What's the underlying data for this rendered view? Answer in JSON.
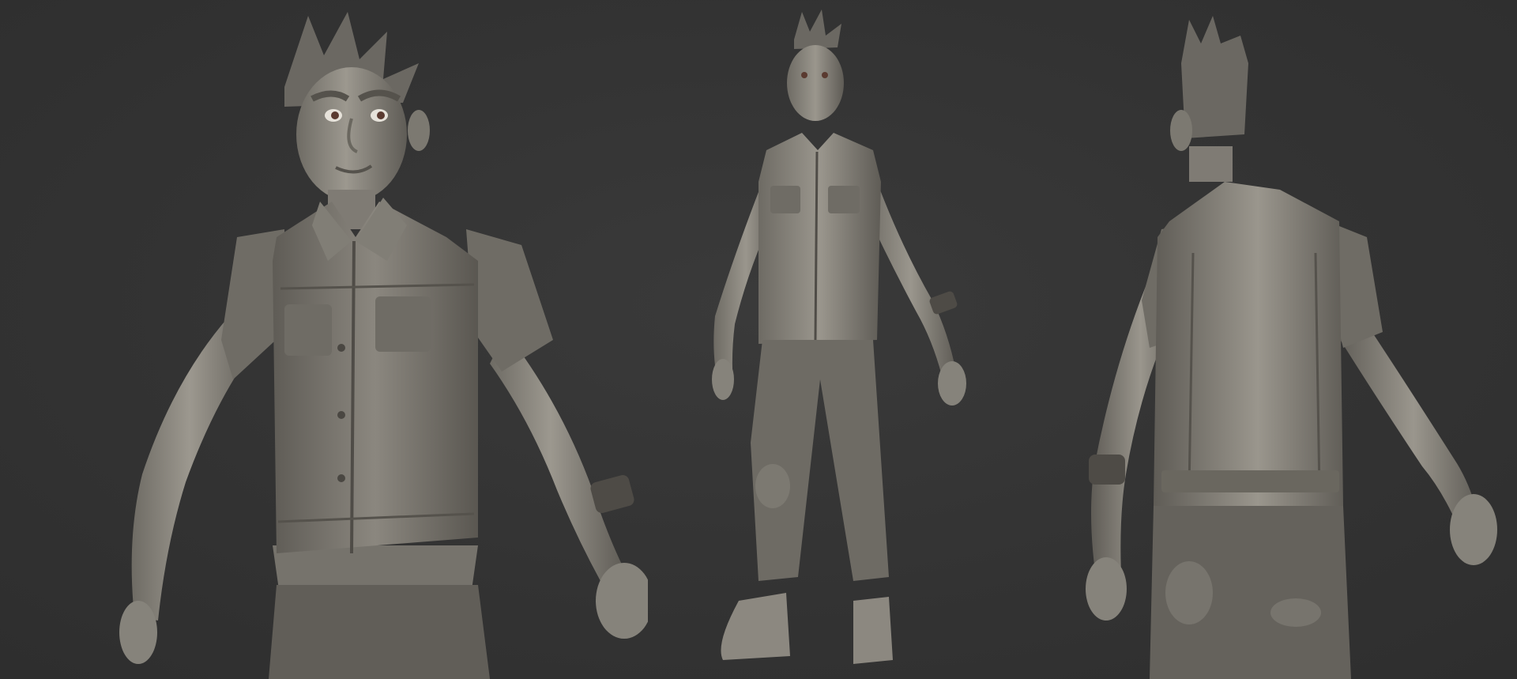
{
  "image": {
    "background_color": "#333333",
    "clay_color": "#8a877f",
    "clay_shadow": "#5e5b55",
    "clay_highlight": "#b3afa6",
    "views": [
      {
        "id": "front-three-quarter-closeup",
        "visible_text": ""
      },
      {
        "id": "full-body-front",
        "visible_text": ""
      },
      {
        "id": "back-three-quarter",
        "visible_text": ""
      }
    ]
  }
}
